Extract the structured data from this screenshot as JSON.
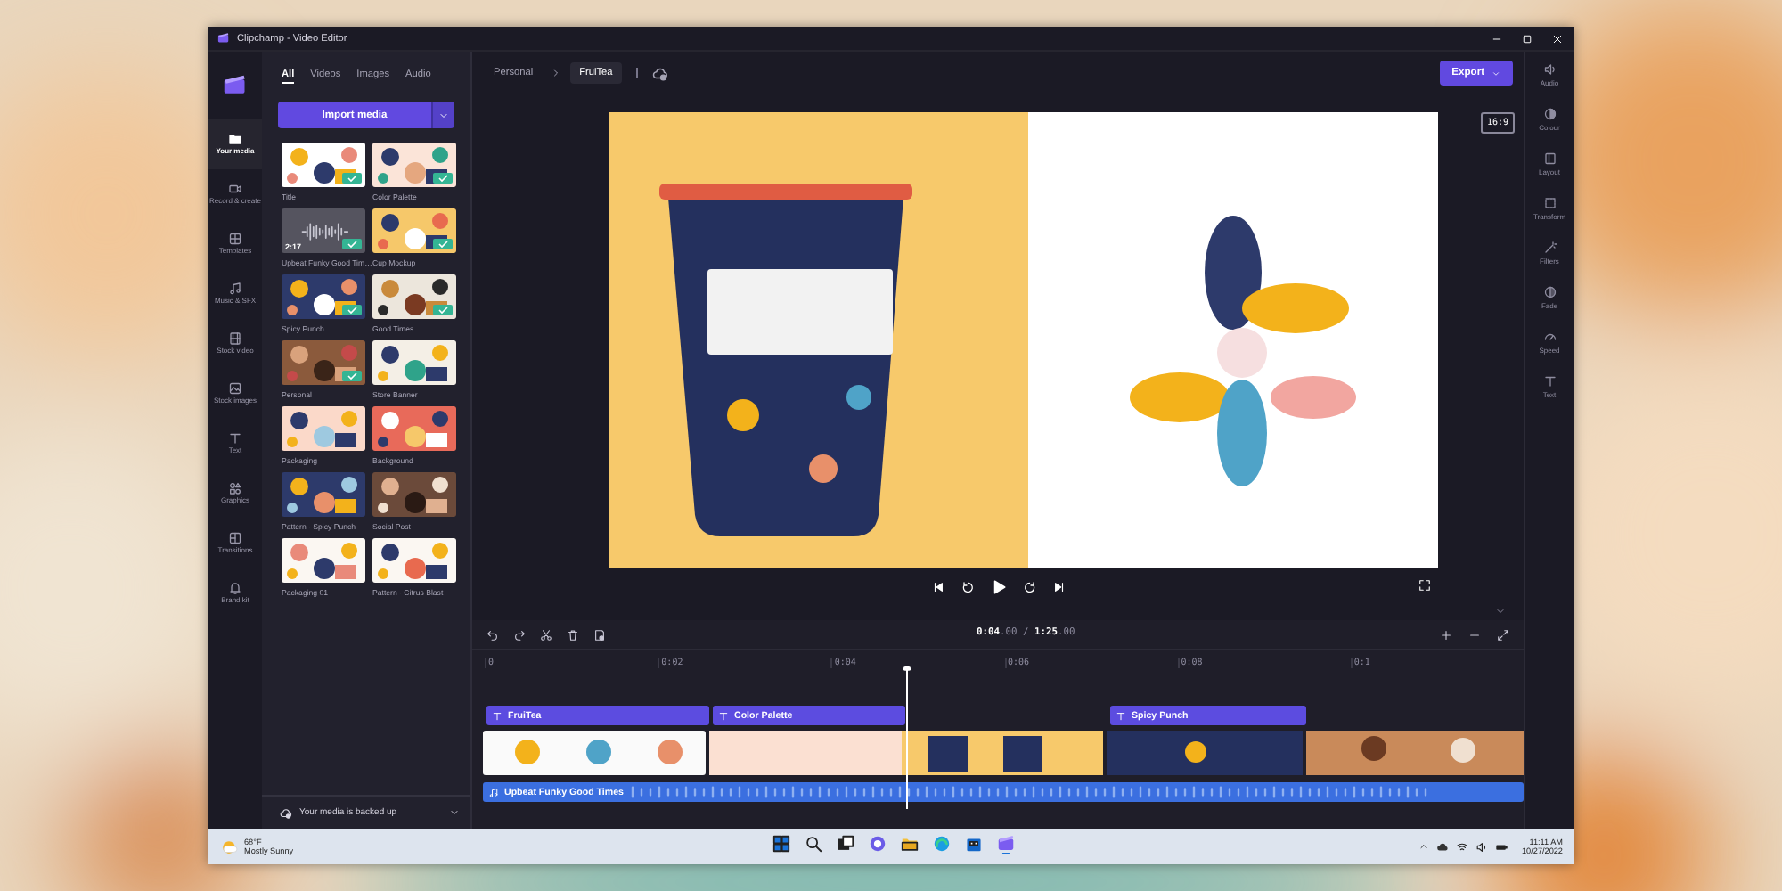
{
  "window": {
    "title": "Clipchamp - Video Editor"
  },
  "nav": {
    "items": [
      {
        "label": "Your media",
        "selected": true
      },
      {
        "label": "Record & create",
        "selected": false
      },
      {
        "label": "Templates",
        "selected": false
      },
      {
        "label": "Music & SFX",
        "selected": false
      },
      {
        "label": "Stock video",
        "selected": false
      },
      {
        "label": "Stock images",
        "selected": false
      },
      {
        "label": "Text",
        "selected": false
      },
      {
        "label": "Graphics",
        "selected": false
      },
      {
        "label": "Transitions",
        "selected": false
      },
      {
        "label": "Brand kit",
        "selected": false
      }
    ]
  },
  "media": {
    "tabs": [
      {
        "label": "All",
        "selected": true
      },
      {
        "label": "Videos",
        "selected": false
      },
      {
        "label": "Images",
        "selected": false
      },
      {
        "label": "Audio",
        "selected": false
      }
    ],
    "import_button": "Import media",
    "items": [
      {
        "label": "Title",
        "kind": "picture",
        "added": true
      },
      {
        "label": "Color Palette",
        "kind": "picture",
        "added": true
      },
      {
        "label": "Upbeat Funky Good Tim…",
        "kind": "audio",
        "duration": "2:17",
        "added": true
      },
      {
        "label": "Cup Mockup",
        "kind": "picture",
        "added": true
      },
      {
        "label": "Spicy Punch",
        "kind": "picture",
        "added": true
      },
      {
        "label": "Good Times",
        "kind": "picture",
        "added": true
      },
      {
        "label": "Personal",
        "kind": "picture",
        "added": true
      },
      {
        "label": "Store Banner",
        "kind": "picture",
        "added": false
      },
      {
        "label": "Packaging",
        "kind": "picture",
        "added": false
      },
      {
        "label": "Background",
        "kind": "picture",
        "added": false
      },
      {
        "label": "Pattern - Spicy Punch",
        "kind": "picture",
        "added": false
      },
      {
        "label": "Social Post",
        "kind": "picture",
        "added": false
      },
      {
        "label": "Packaging 01",
        "kind": "picture",
        "added": false
      },
      {
        "label": "Pattern - Citrus Blast",
        "kind": "picture",
        "added": false
      }
    ],
    "backup_status": "Your media is backed up"
  },
  "breadcrumb": [
    {
      "label": "Personal",
      "selected": false
    },
    {
      "label": "FruiTea",
      "selected": true
    }
  ],
  "export_button": "Export",
  "aspect_ratio": "16:9",
  "timeline": {
    "time_display": "**0:04**.00 / **1:25**.00",
    "ruler": [
      "0",
      "0:02",
      "0:04",
      "0:06",
      "0:08",
      "0:1"
    ],
    "text_clips": [
      {
        "label": "FruiTea"
      },
      {
        "label": "Color Palette"
      },
      {
        "label": "Spicy Punch"
      }
    ],
    "audio_clip": "Upbeat Funky Good Times"
  },
  "right_panel": {
    "items": [
      "Audio",
      "Colour",
      "Layout",
      "Transform",
      "Filters",
      "Fade",
      "Speed",
      "Text"
    ]
  },
  "taskbar": {
    "weather": {
      "temperature": "68°F",
      "condition": "Mostly Sunny"
    },
    "apps": [
      {
        "running": false
      },
      {
        "running": false
      },
      {
        "running": false
      },
      {
        "running": false
      },
      {
        "running": false
      },
      {
        "running": false
      },
      {
        "running": false
      },
      {
        "running": true
      }
    ],
    "clock": {
      "time": "11:11 AM",
      "date": "10/27/2022"
    }
  }
}
